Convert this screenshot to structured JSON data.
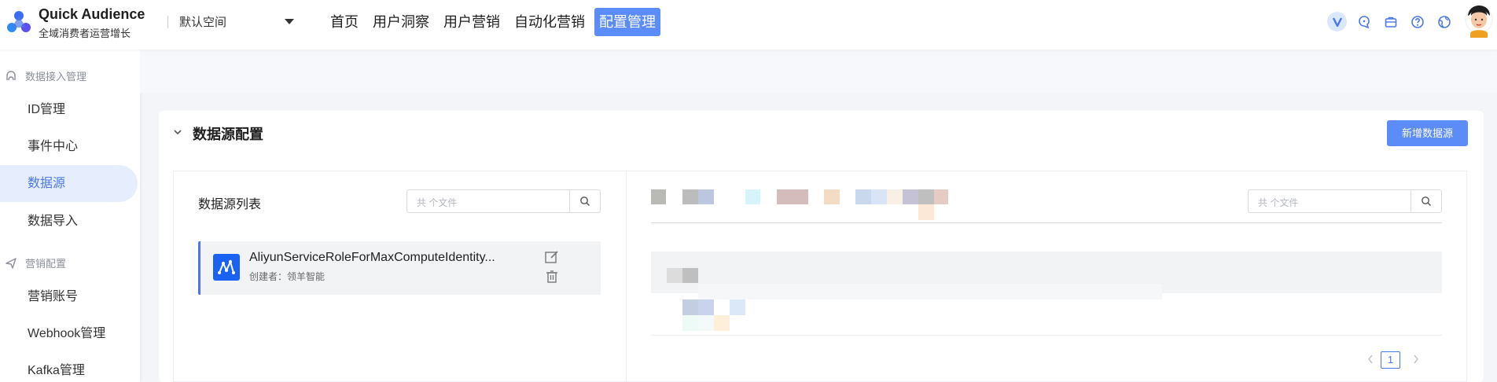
{
  "header": {
    "brand_title": "Quick Audience",
    "brand_subtitle": "全域消费者运营增长",
    "workspace": "默认空间",
    "nav": [
      {
        "label": "首页",
        "active": false
      },
      {
        "label": "用户洞察",
        "active": false
      },
      {
        "label": "用户营销",
        "active": false
      },
      {
        "label": "自动化营销",
        "active": false
      },
      {
        "label": "配置管理",
        "active": true
      }
    ],
    "icons": [
      "v-icon",
      "help-chat-icon",
      "briefcase-icon",
      "question-icon",
      "globe-icon"
    ]
  },
  "sidebar": {
    "group1": "数据接入管理",
    "group1_items": [
      "ID管理",
      "事件中心",
      "数据源",
      "数据导入"
    ],
    "active_item": "数据源",
    "group2": "营销配置",
    "group2_items": [
      "营销账号",
      "Webhook管理",
      "Kafka管理"
    ]
  },
  "main": {
    "section_title": "数据源配置",
    "new_button": "新增数据源",
    "list": {
      "title": "数据源列表",
      "search_placeholder": "共   个文件",
      "items": [
        {
          "name": "AliyunServiceRoleForMaxComputeIdentity...",
          "creator": "创建者：领羊智能"
        }
      ]
    },
    "detail": {
      "search_placeholder": "共   个文件",
      "page": "1"
    }
  },
  "colors": {
    "accent": "#5b8cf7",
    "active_text": "#4a78e8",
    "active_bg": "#e6eefd"
  }
}
